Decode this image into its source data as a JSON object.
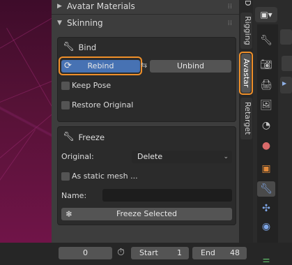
{
  "sidebar": {
    "avatar_materials_header": "Avatar Materials",
    "skinning_header": "Skinning"
  },
  "bind": {
    "title": "Bind",
    "rebind_label": "Rebind",
    "unbind_label": "Unbind",
    "keep_pose_label": "Keep Pose",
    "restore_original_label": "Restore Original"
  },
  "freeze": {
    "title": "Freeze",
    "original_label": "Original:",
    "original_value": "Delete",
    "static_mesh_label": "As static mesh ...",
    "name_label": "Name:",
    "name_value": "",
    "freeze_selected_label": "Freeze Selected"
  },
  "tabs": {
    "top_partial": "D",
    "rigging": "Rigging",
    "avastar": "Avastar",
    "retarget": "Retarget"
  },
  "timeline": {
    "current_frame": "0",
    "start_label": "Start",
    "start_value": "1",
    "end_label": "End",
    "end_value": "48"
  },
  "colors": {
    "highlight_orange": "#f0902a",
    "active_blue": "#4772b3",
    "viewport_magenta": "#5a1238"
  },
  "icons": {
    "bind": "wrench-icon",
    "freeze": "wrench-icon",
    "rebind": "refresh-icon",
    "freeze_selected": "snowflake-icon",
    "timeline": "stopwatch-icon"
  }
}
